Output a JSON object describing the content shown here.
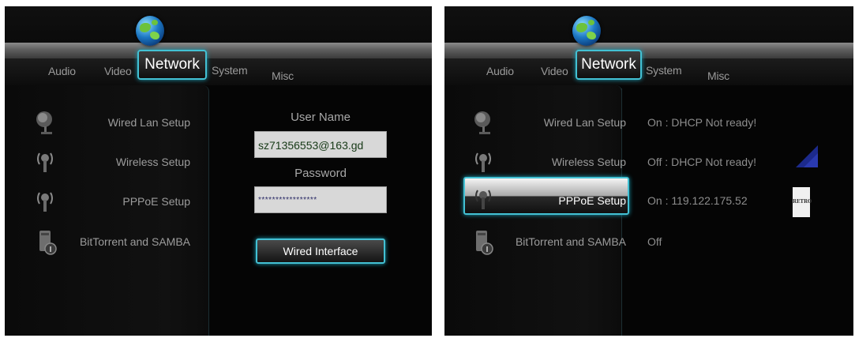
{
  "left": {
    "tabs": [
      "Audio",
      "Video",
      "Network",
      "System",
      "Misc"
    ],
    "menu": [
      "Wired Lan Setup",
      "Wireless Setup",
      "PPPoE Setup",
      "BitTorrent and SAMBA"
    ],
    "username_label": "User Name",
    "username_value": "sz71356553@163.gd",
    "password_label": "Password",
    "password_value": "*****************",
    "interface_button": "Wired Interface"
  },
  "right": {
    "tabs": [
      "Audio",
      "Video",
      "Network",
      "System",
      "Misc"
    ],
    "menu": [
      "Wired Lan Setup",
      "Wireless Setup",
      "PPPoE Setup",
      "BitTorrent and SAMBA"
    ],
    "statuses": [
      "On : DHCP Not ready!",
      "Off : DHCP Not ready!",
      "On : 119.122.175.52",
      "Off"
    ],
    "badge": "RETRO"
  },
  "colors": {
    "accent": "#43c1d4",
    "background": "#050505",
    "field": "#d8d8d8"
  },
  "icons": [
    "globe-icon",
    "wired-lan-icon",
    "wireless-icon",
    "pppoe-icon",
    "bittorrent-icon",
    "signal-strength-icon"
  ]
}
